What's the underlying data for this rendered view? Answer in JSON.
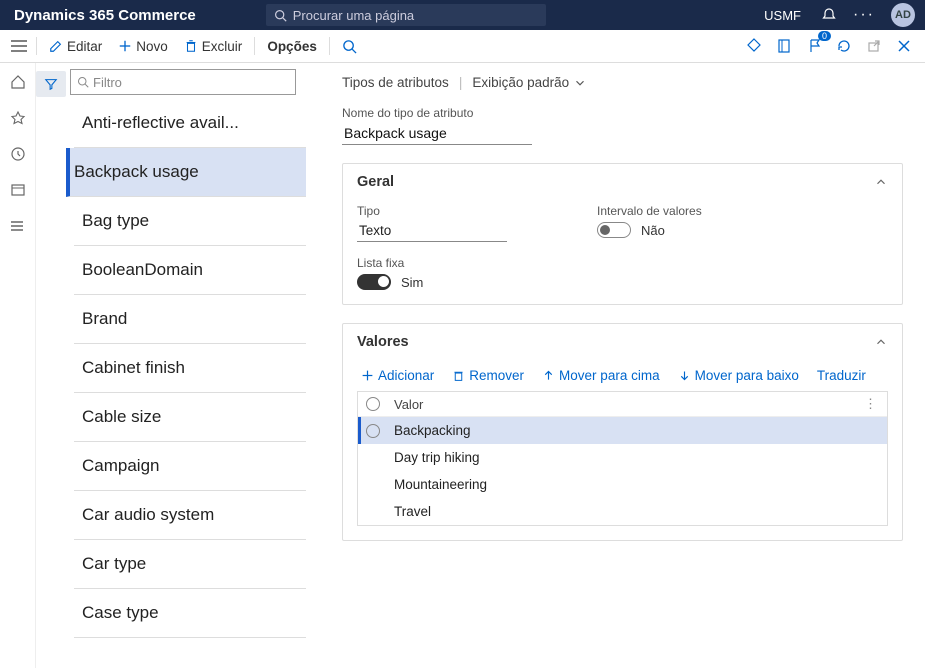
{
  "topbar": {
    "brand": "Dynamics 365 Commerce",
    "search_placeholder": "Procurar uma página",
    "entity": "USMF",
    "avatar": "AD"
  },
  "cmdbar": {
    "edit": "Editar",
    "new": "Novo",
    "delete": "Excluir",
    "options": "Opções",
    "badge": "0"
  },
  "list": {
    "filter_placeholder": "Filtro",
    "items": [
      "Anti-reflective avail...",
      "Backpack usage",
      "Bag type",
      "BooleanDomain",
      "Brand",
      "Cabinet finish",
      "Cable size",
      "Campaign",
      "Car audio system",
      "Car type",
      "Case type"
    ],
    "selected_index": 1
  },
  "detail": {
    "breadcrumb": "Tipos de atributos",
    "display": "Exibição padrão",
    "name_label": "Nome do tipo de atributo",
    "name_value": "Backpack usage"
  },
  "sections": {
    "general": {
      "title": "Geral",
      "type_label": "Tipo",
      "type_value": "Texto",
      "fixed_label": "Lista fixa",
      "fixed_value": "Sim",
      "range_label": "Intervalo de valores",
      "range_value": "Não"
    },
    "values": {
      "title": "Valores",
      "toolbar": {
        "add": "Adicionar",
        "remove": "Remover",
        "up": "Mover para cima",
        "down": "Mover para baixo",
        "translate": "Traduzir"
      },
      "col_header": "Valor",
      "rows": [
        "Backpacking",
        "Day trip hiking",
        "Mountaineering",
        "Travel"
      ],
      "selected_row": 0
    }
  }
}
